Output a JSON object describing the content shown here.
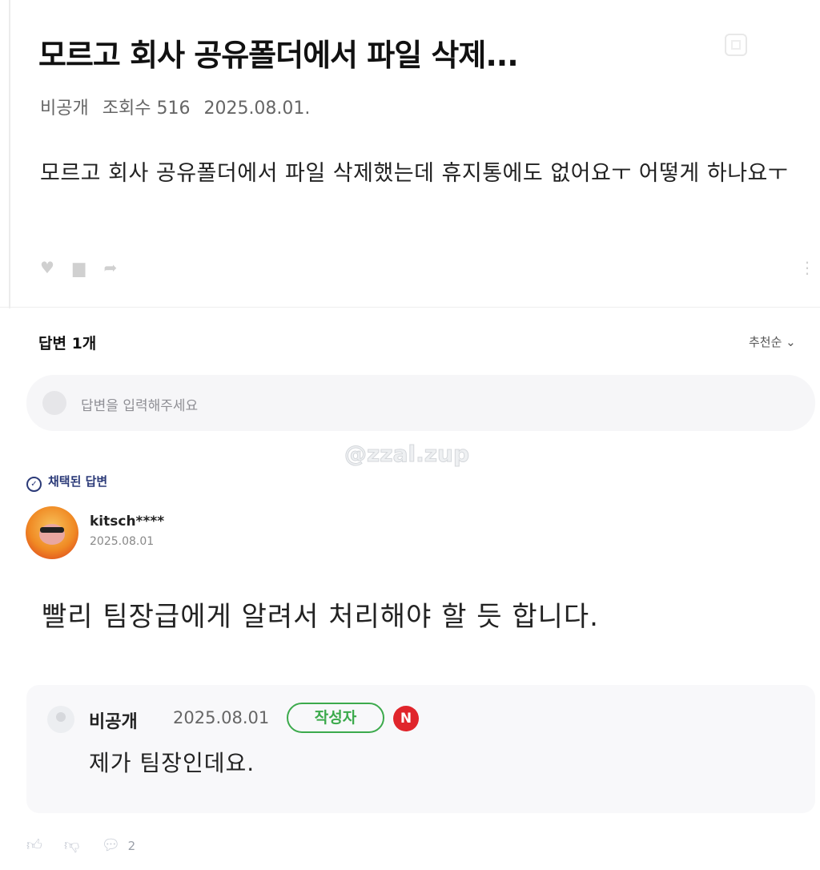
{
  "post": {
    "title": "모르고 회사 공유폴더에서 파일 삭제...",
    "author": "비공개",
    "views_label": "조회수 516",
    "date": "2025.08.01.",
    "body": "모르고 회사 공유폴더에서 파일 삭제했는데 휴지통에도 없어요ㅜ 어떻게 하나요ㅜ",
    "icons": {
      "like": "heart-icon",
      "comment": "comment-icon",
      "share": "share-icon",
      "more": "more-vertical-icon",
      "corner": "image-icon"
    }
  },
  "answers": {
    "header": "답변 1개",
    "sort_label": "추천순 ⌄",
    "input_placeholder": "답변을 입력해주세요"
  },
  "watermark": "@zzal.zup",
  "accepted_answer": {
    "badge": "채택된 답변",
    "username": "kitsch****",
    "date": "2025.08.01",
    "text": "빨리 팀장급에게 알려서 처리해야 할 듯 합니다."
  },
  "reply": {
    "name": "비공개",
    "date": "2025.08.01",
    "author_badge": "작성자",
    "new_badge": "N",
    "text": "제가 팀장인데요."
  },
  "answer_actions": {
    "comment_count": "2"
  },
  "colors": {
    "accent_navy": "#2b3a78",
    "badge_green": "#3caa4c",
    "new_red": "#e0252b"
  }
}
